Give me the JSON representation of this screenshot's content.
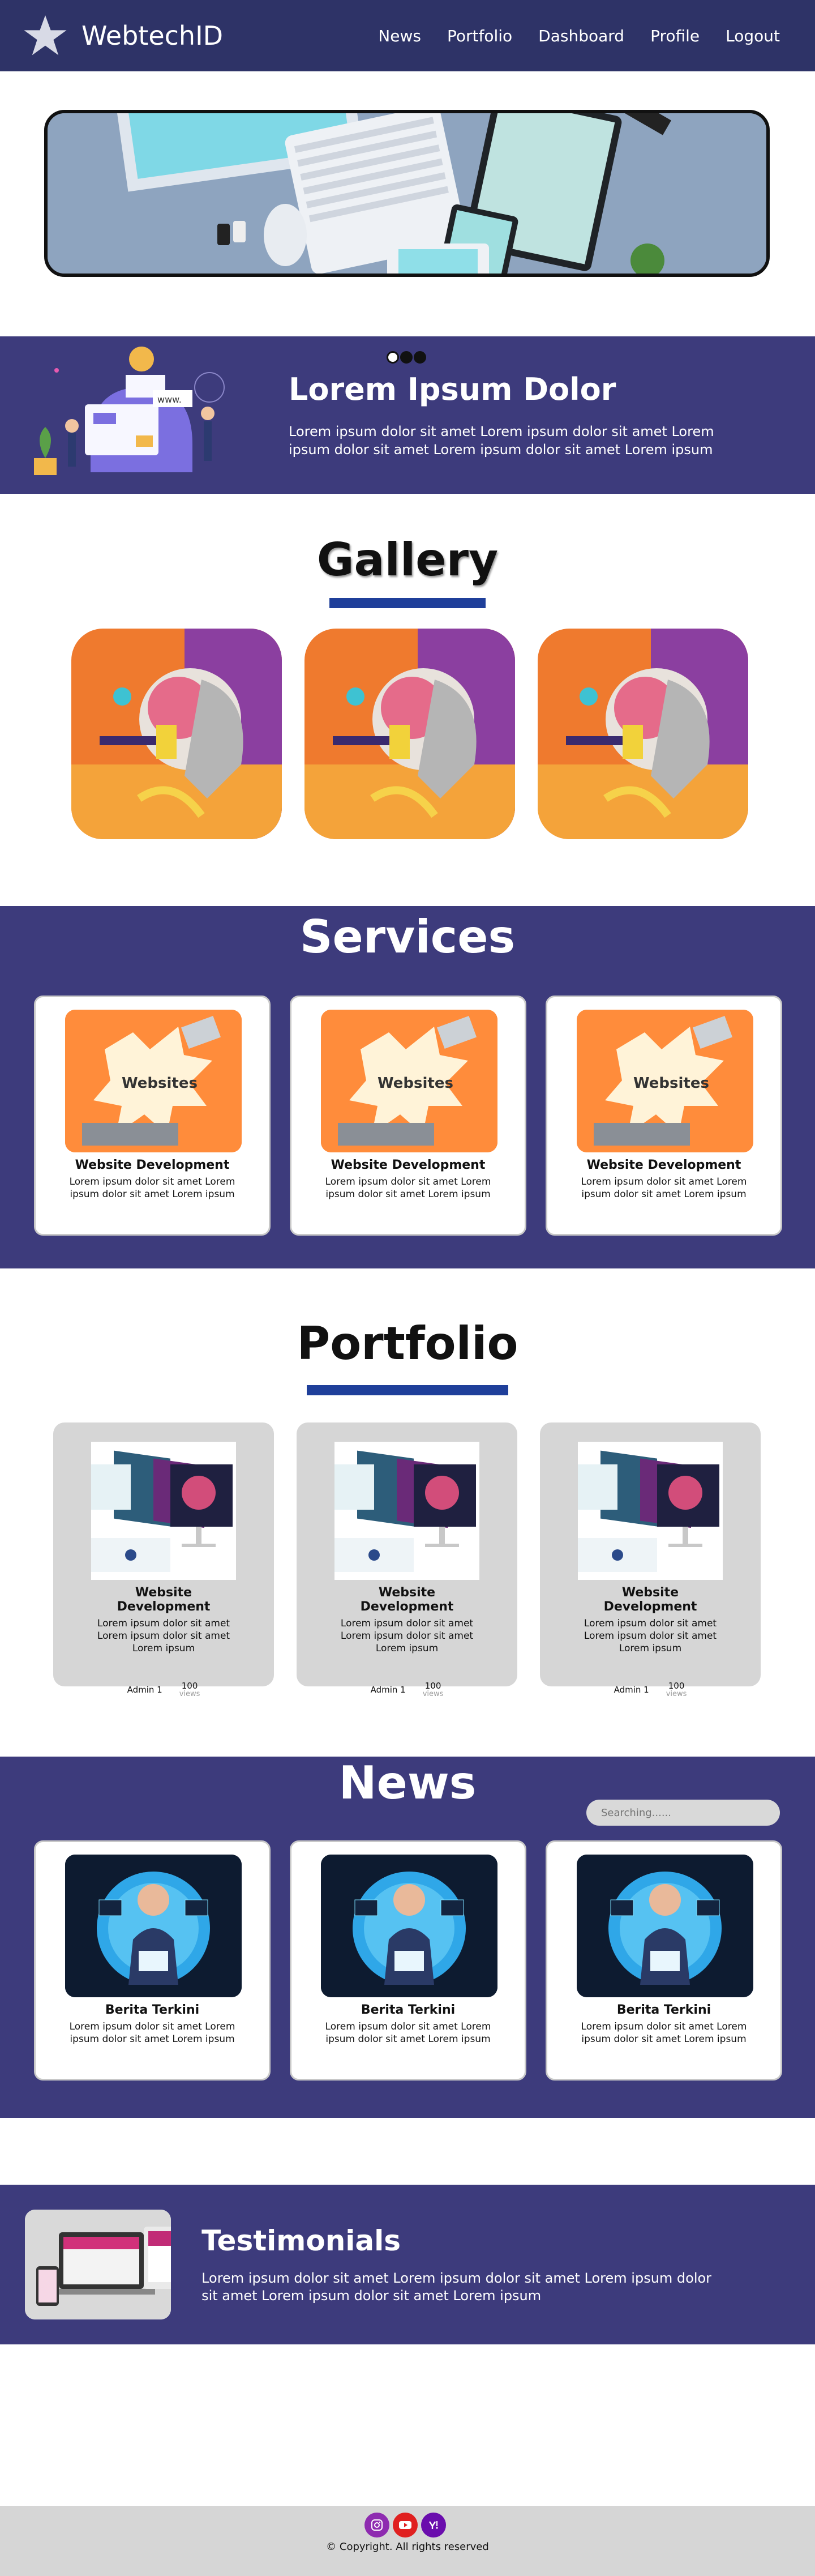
{
  "nav": {
    "brand": "WebtechID",
    "items": [
      {
        "label": "News"
      },
      {
        "label": "Portfolio"
      },
      {
        "label": "Dashboard"
      },
      {
        "label": "Profile"
      },
      {
        "label": "Logout"
      }
    ]
  },
  "hero": {
    "slides": 3,
    "active_slide": 1
  },
  "about": {
    "title": "Lorem Ipsum Dolor",
    "body": "Lorem ipsum dolor sit amet Lorem ipsum dolor sit amet Lorem ipsum dolor sit amet Lorem ipsum dolor sit amet Lorem ipsum",
    "illustration_text": "www."
  },
  "gallery": {
    "title": "Gallery"
  },
  "services": {
    "title": "Services",
    "cards": [
      {
        "image_text": "Websites",
        "title": "Website Development",
        "body": "Lorem ipsum dolor sit amet Lorem ipsum dolor sit amet Lorem ipsum"
      },
      {
        "image_text": "Websites",
        "title": "Website Development",
        "body": "Lorem ipsum dolor sit amet Lorem ipsum dolor sit amet Lorem ipsum"
      },
      {
        "image_text": "Websites",
        "title": "Website Development",
        "body": "Lorem ipsum dolor sit amet Lorem ipsum dolor sit amet Lorem ipsum"
      }
    ]
  },
  "portfolio": {
    "title": "Portfolio",
    "cards": [
      {
        "title": "Website Development",
        "body": "Lorem ipsum dolor sit amet Lorem ipsum dolor sit amet Lorem ipsum",
        "author": "Admin 1",
        "views_count": "100",
        "views_label": "views"
      },
      {
        "title": "Website Development",
        "body": "Lorem ipsum dolor sit amet Lorem ipsum dolor sit amet Lorem ipsum",
        "author": "Admin 1",
        "views_count": "100",
        "views_label": "views"
      },
      {
        "title": "Website Development",
        "body": "Lorem ipsum dolor sit amet Lorem ipsum dolor sit amet Lorem ipsum",
        "author": "Admin 1",
        "views_count": "100",
        "views_label": "views"
      }
    ]
  },
  "news": {
    "title": "News",
    "search_placeholder": "Searching......",
    "cards": [
      {
        "title": "Berita Terkini",
        "body": "Lorem ipsum dolor sit amet Lorem ipsum dolor sit amet Lorem ipsum"
      },
      {
        "title": "Berita Terkini",
        "body": "Lorem ipsum dolor sit amet Lorem ipsum dolor sit amet Lorem ipsum"
      },
      {
        "title": "Berita Terkini",
        "body": "Lorem ipsum dolor sit amet Lorem ipsum dolor sit amet Lorem ipsum"
      }
    ]
  },
  "testimonials": {
    "title": "Testimonials",
    "body": "Lorem ipsum dolor sit amet Lorem ipsum dolor sit amet Lorem ipsum dolor sit amet Lorem ipsum dolor sit amet Lorem ipsum"
  },
  "footer": {
    "copyright": "© Copyright. All rights reserved",
    "socials": [
      {
        "icon": "instagram-icon",
        "color": "#8e2bb0"
      },
      {
        "icon": "youtube-icon",
        "color": "#e02020"
      },
      {
        "icon": "yahoo-icon",
        "color": "#6a0dad"
      }
    ]
  },
  "colors": {
    "nav_bg": "#2e3367",
    "section_bg": "#3d3b7c",
    "underline": "#1f3f9a",
    "card_grey": "#d6d6d6"
  }
}
